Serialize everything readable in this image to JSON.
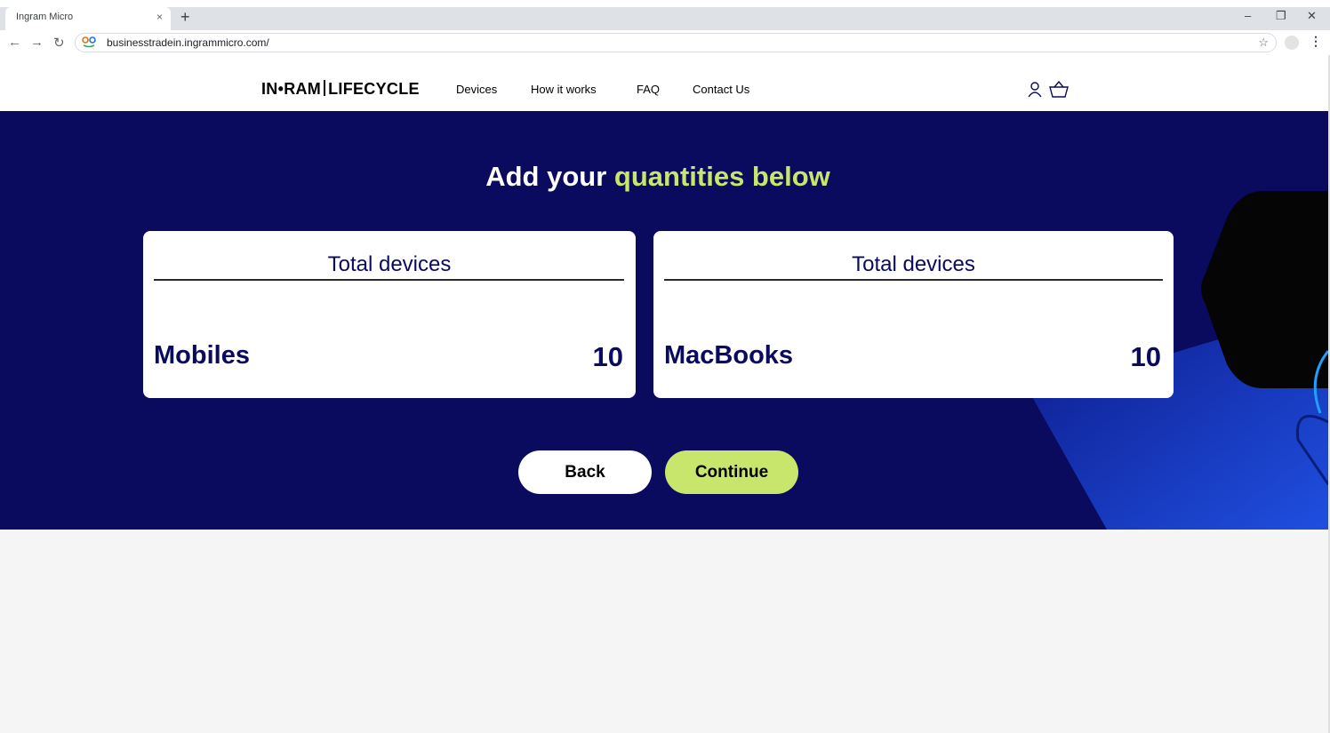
{
  "browser": {
    "tab_title": "Ingram Micro",
    "tab_close": "×",
    "new_tab": "+",
    "url": "businesstradein.ingrammicro.com/",
    "controls": {
      "minimize": "–",
      "restore": "❐",
      "close": "✕"
    },
    "nav": {
      "back": "←",
      "forward": "→",
      "reload": "↻"
    },
    "star": "☆",
    "menu": "⋮"
  },
  "header": {
    "logo_left": "IN•RAM",
    "logo_right": "LIFECYCLE",
    "nav": [
      "Devices",
      "How it works",
      "FAQ",
      "Contact Us"
    ],
    "icons": [
      "user-icon",
      "basket-icon"
    ]
  },
  "hero": {
    "title_prefix": "Add your",
    "title_accent": "quantities below",
    "accent_color": "#c8e66b",
    "background": "#0a0a5f"
  },
  "cards": [
    {
      "heading": "Total devices",
      "label": "Mobiles",
      "value": "10"
    },
    {
      "heading": "Total devices",
      "label": "MacBooks",
      "value": "10"
    }
  ],
  "actions": {
    "back": "Back",
    "continue": "Continue"
  }
}
